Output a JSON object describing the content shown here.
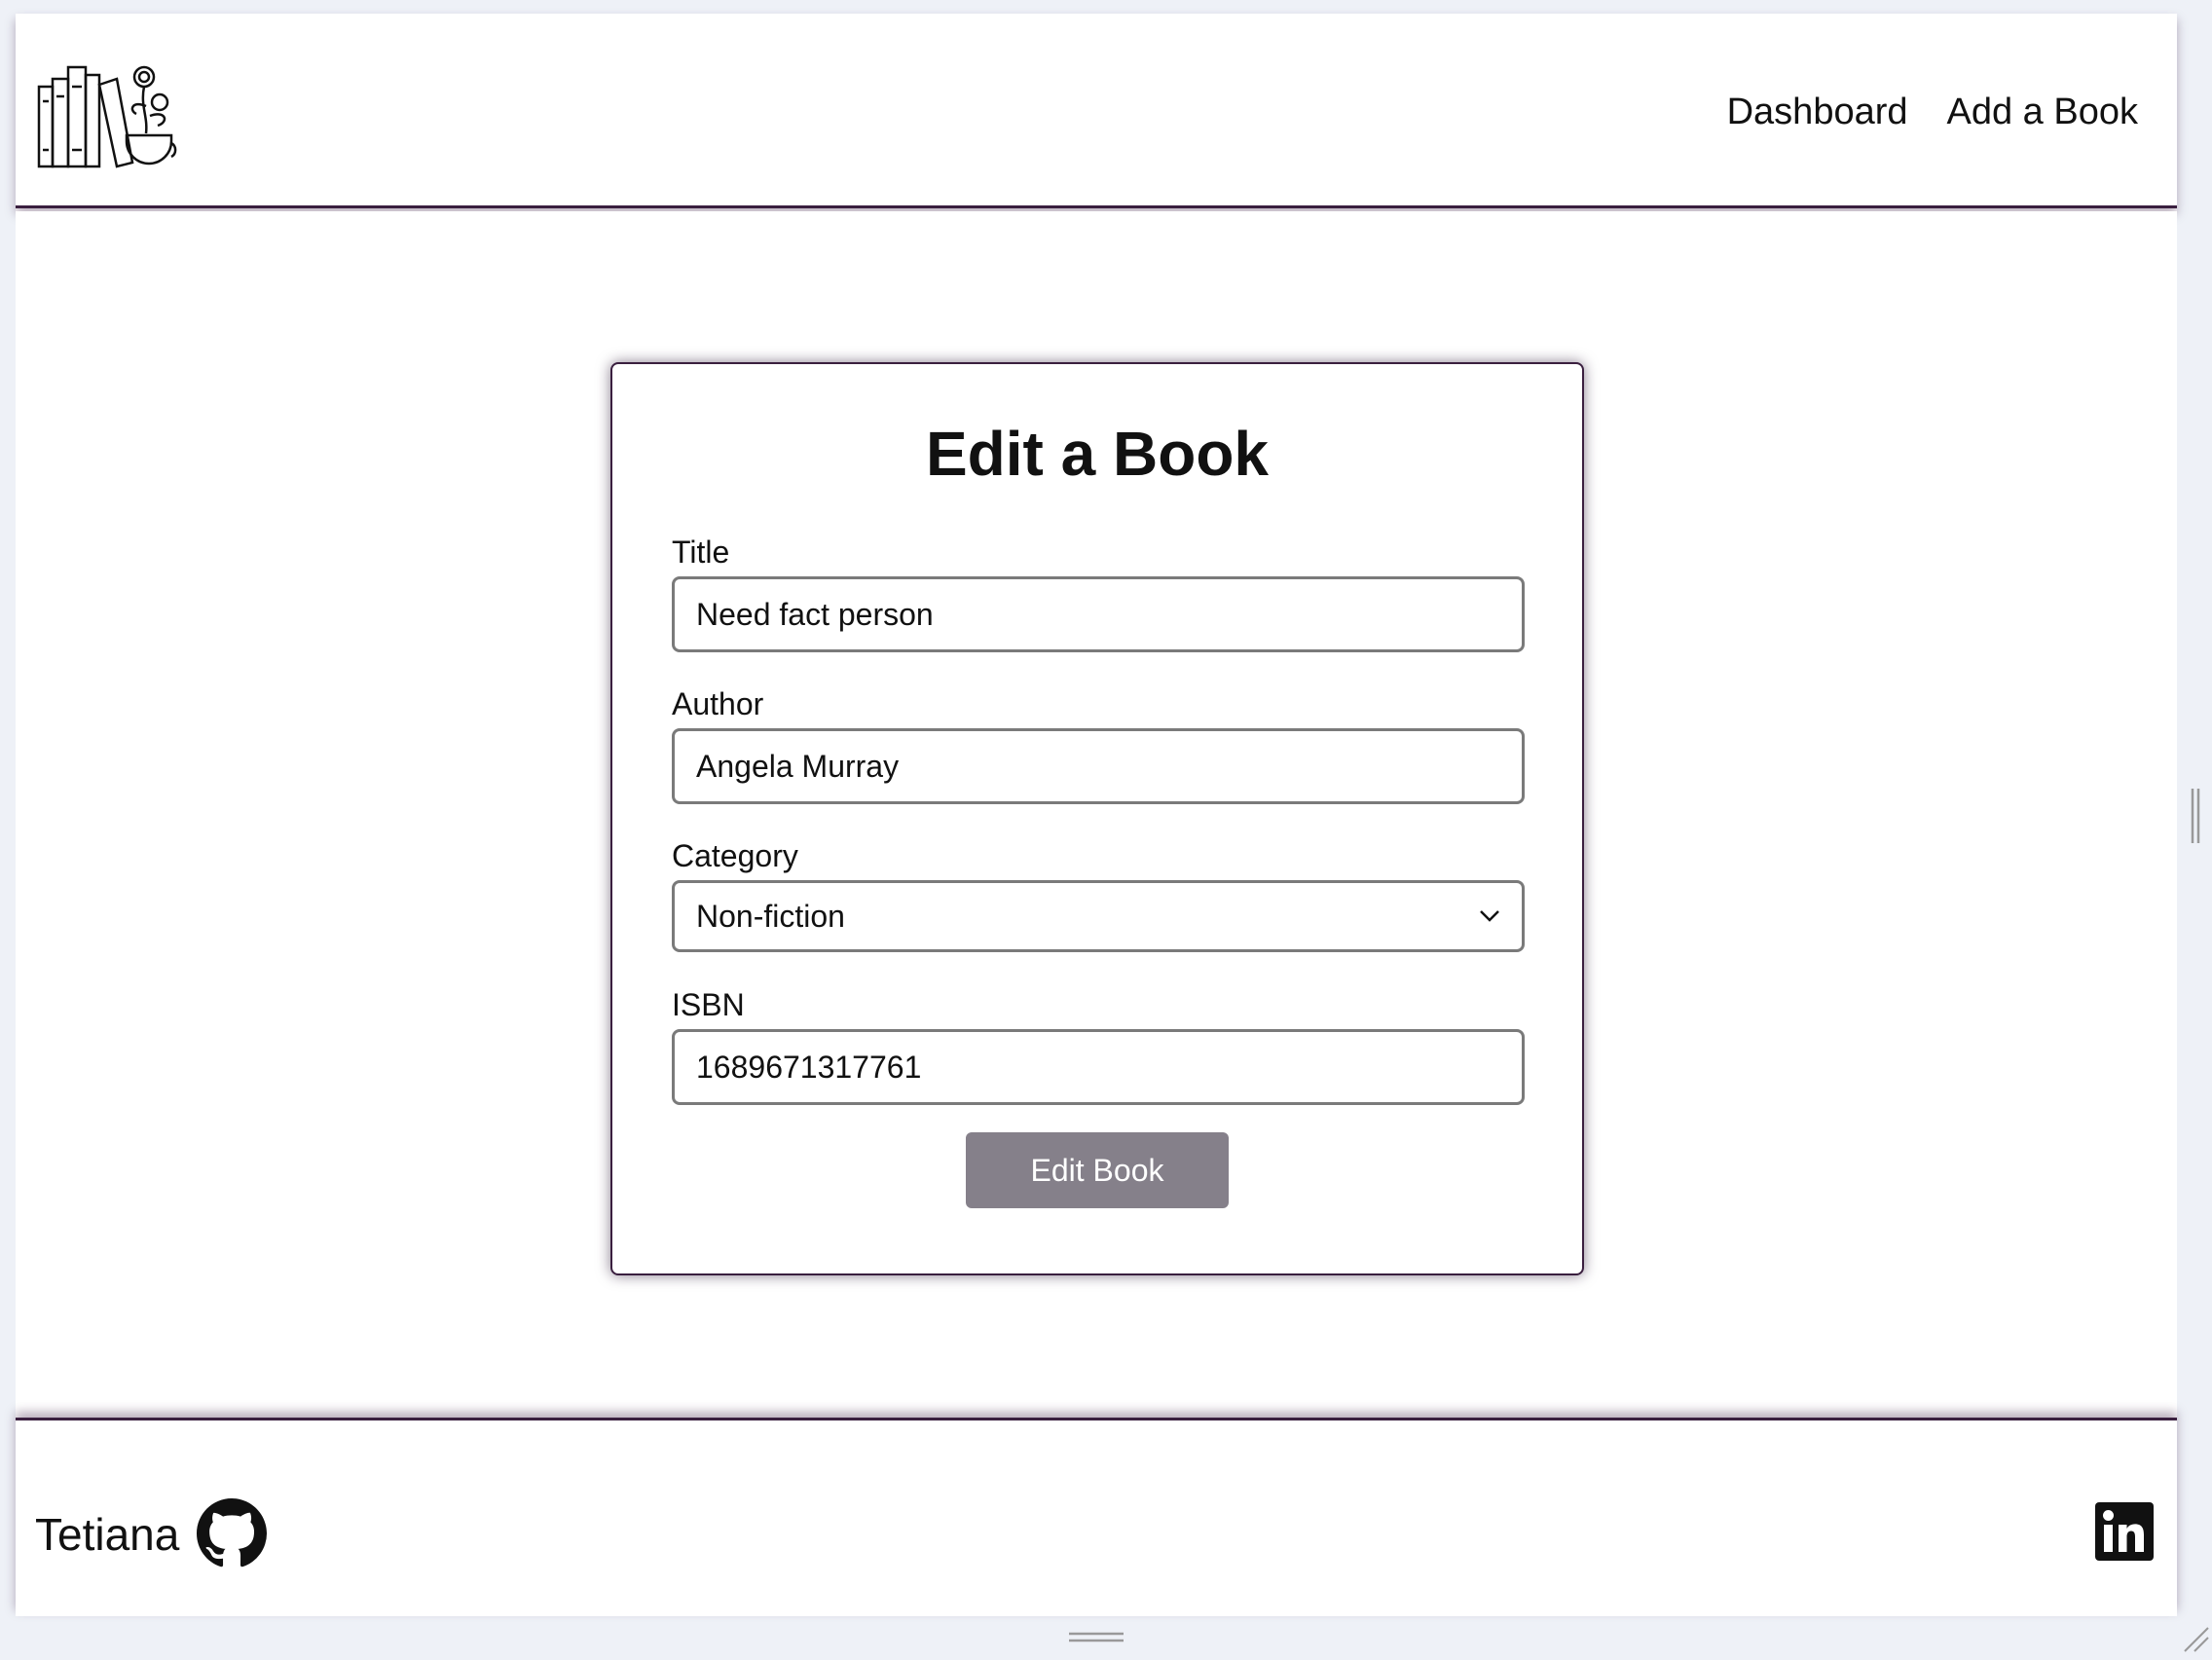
{
  "nav": {
    "dashboard": "Dashboard",
    "add_book": "Add a Book"
  },
  "form": {
    "heading": "Edit a Book",
    "title_label": "Title",
    "title_value": "Need fact person",
    "author_label": "Author",
    "author_value": "Angela Murray",
    "category_label": "Category",
    "category_value": "Non-fiction",
    "isbn_label": "ISBN",
    "isbn_value": "1689671317761",
    "submit_label": "Edit Book"
  },
  "footer": {
    "author_name": "Tetiana",
    "github_icon": "github-icon",
    "linkedin_icon": "linkedin-icon"
  },
  "colors": {
    "accent_border": "#3a1f3f",
    "button_bg": "#85808a",
    "page_bg": "#ffffff"
  }
}
